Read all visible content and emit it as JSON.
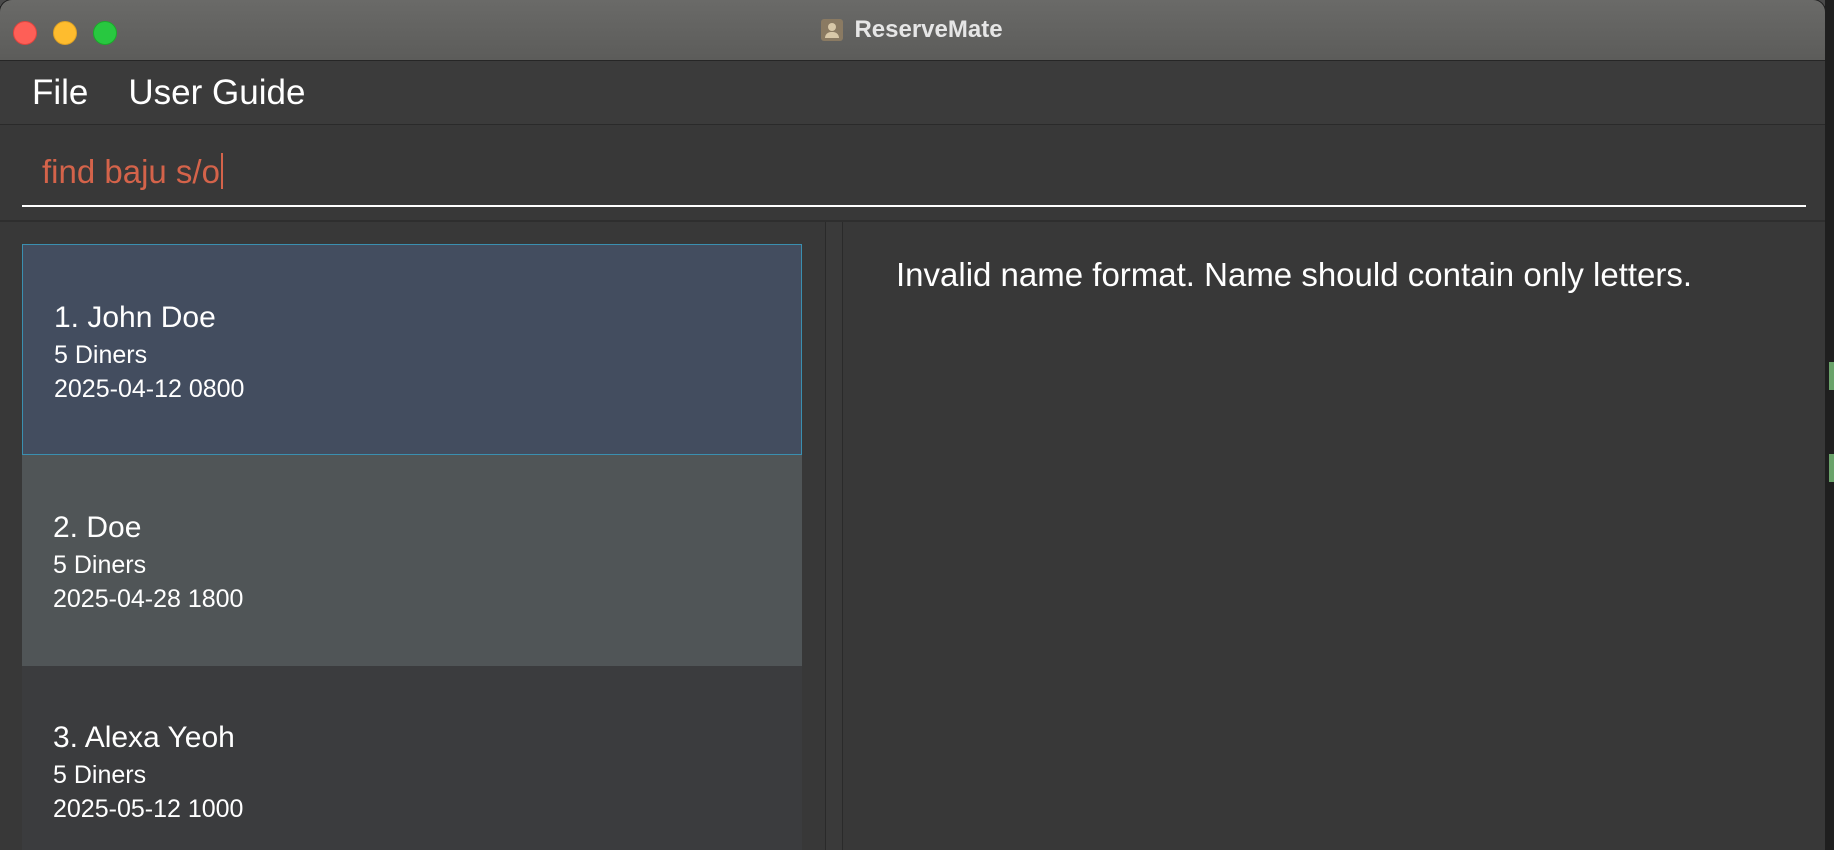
{
  "window": {
    "title": "ReserveMate"
  },
  "menu": {
    "items": [
      "File",
      "User Guide"
    ]
  },
  "command": {
    "value": "find baju s/o"
  },
  "result": {
    "message": "Invalid name format. Name should contain only letters."
  },
  "reservations": [
    {
      "name": "1. John Doe",
      "diners": "5 Diners",
      "datetime": "2025-04-12 0800"
    },
    {
      "name": "2. Doe",
      "diners": "5 Diners",
      "datetime": "2025-04-28 1800"
    },
    {
      "name": "3. Alexa Yeoh",
      "diners": "5 Diners",
      "datetime": "2025-05-12 1000"
    }
  ],
  "colors": {
    "command_text": "#d4634a",
    "selected_card": "#434d5f",
    "selected_border": "#3a8fb0"
  }
}
